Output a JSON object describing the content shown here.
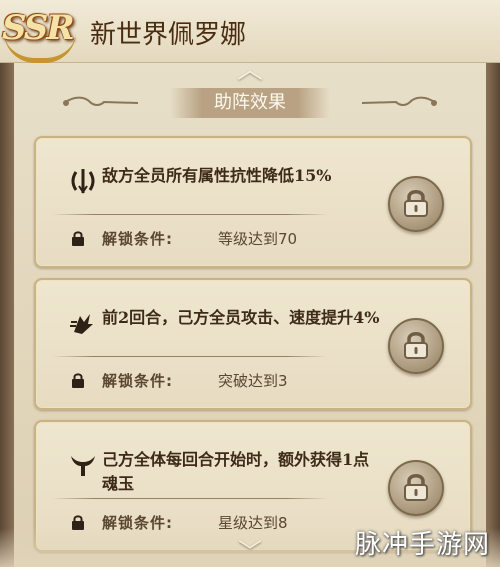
{
  "header": {
    "rarity": "SSR",
    "character_name": "新世界佩罗娜"
  },
  "section": {
    "title": "助阵效果"
  },
  "cards": [
    {
      "icon": "resistance-icon",
      "description": "敌方全员所有属性抗性降低15%",
      "condition_label": "解锁条件:",
      "condition_value": "等级达到70",
      "locked": true
    },
    {
      "icon": "speed-icon",
      "description": "前2回合，己方全员攻击、速度提升4%",
      "condition_label": "解锁条件:",
      "condition_value": "突破达到3",
      "locked": true
    },
    {
      "icon": "horn-icon",
      "description": "己方全体每回合开始时，额外获得1点魂玉",
      "condition_label": "解锁条件:",
      "condition_value": "星级达到8",
      "locked": true
    }
  ],
  "watermark": "脉冲手游网",
  "colors": {
    "parchment": "#e7dcc2",
    "card_border": "#c9b284",
    "text_dark": "#3d2a18",
    "accent_gold": "#c6952f"
  }
}
